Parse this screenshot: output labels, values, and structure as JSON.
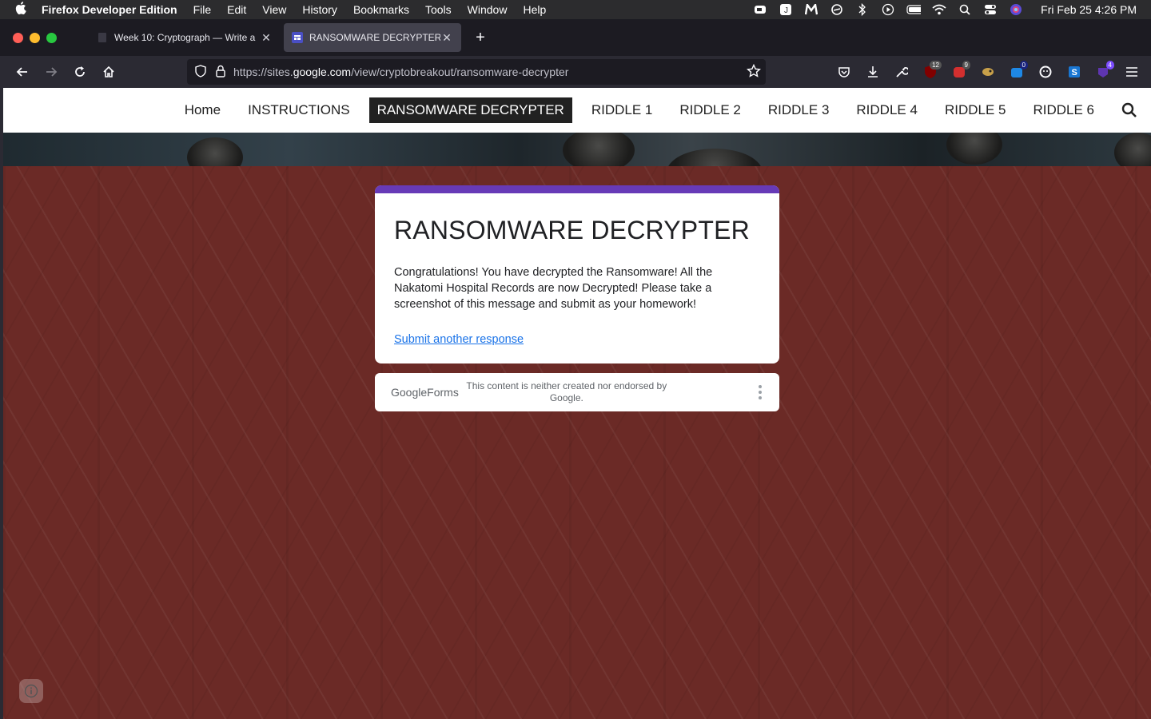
{
  "menubar": {
    "app_name": "Firefox Developer Edition",
    "menus": [
      "File",
      "Edit",
      "View",
      "History",
      "Bookmarks",
      "Tools",
      "Window",
      "Help"
    ],
    "clock": "Fri Feb 25  4:26 PM"
  },
  "tabs": [
    {
      "title": "Week 10: Cryptograph — Write a",
      "active": false
    },
    {
      "title": "RANSOMWARE DECRYPTER",
      "active": true
    }
  ],
  "urlbar": {
    "url_prefix": "https://sites.",
    "url_domain": "google.com",
    "url_path": "/view/cryptobreakout/ransomware-decrypter"
  },
  "extensions": {
    "badges": [
      "12",
      "9",
      "0",
      "4"
    ]
  },
  "site_nav": {
    "items": [
      "Home",
      "INSTRUCTIONS",
      "RANSOMWARE DECRYPTER",
      "RIDDLE 1",
      "RIDDLE 2",
      "RIDDLE 3",
      "RIDDLE 4",
      "RIDDLE 5",
      "RIDDLE 6"
    ],
    "active_index": 2
  },
  "form": {
    "title": "RANSOMWARE DECRYPTER",
    "message": "Congratulations!  You have decrypted the Ransomware!  All the Nakatomi Hospital Records are now Decrypted!  Please take a screenshot of this message and submit as your homework!",
    "link": "Submit another response",
    "accent_color": "#673ab7"
  },
  "footer": {
    "logo_google": "Google",
    "logo_forms": "Forms",
    "disclaimer": "This content is neither created nor endorsed by Google."
  },
  "colors": {
    "page_background": "#6b2a26",
    "active_nav": "#212121",
    "link": "#1a73e8"
  }
}
